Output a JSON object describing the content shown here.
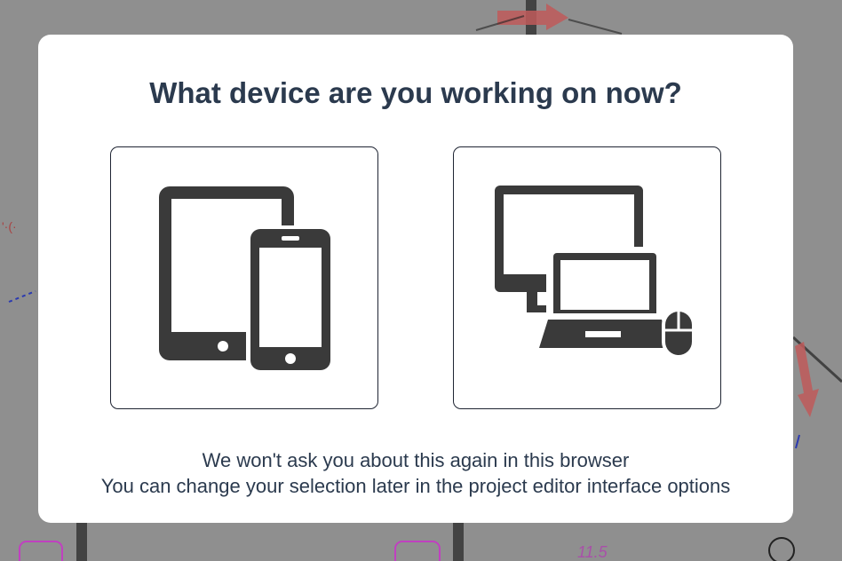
{
  "dialog": {
    "title": "What device are you working on now?",
    "options": [
      {
        "label": "Tablet and phone",
        "icon": "tablet-phone-icon"
      },
      {
        "label": "Desktop and laptop",
        "icon": "desktop-laptop-icon"
      }
    ],
    "note_line1": "We won't ask you about this again in this browser",
    "note_line2": "You can change your selection later in the project editor interface options"
  },
  "colors": {
    "backdrop": "#8f8f8f",
    "dialog_bg": "#ffffff",
    "title": "#2b3a4e",
    "icon": "#3a3a3a",
    "border": "#1f2533"
  }
}
